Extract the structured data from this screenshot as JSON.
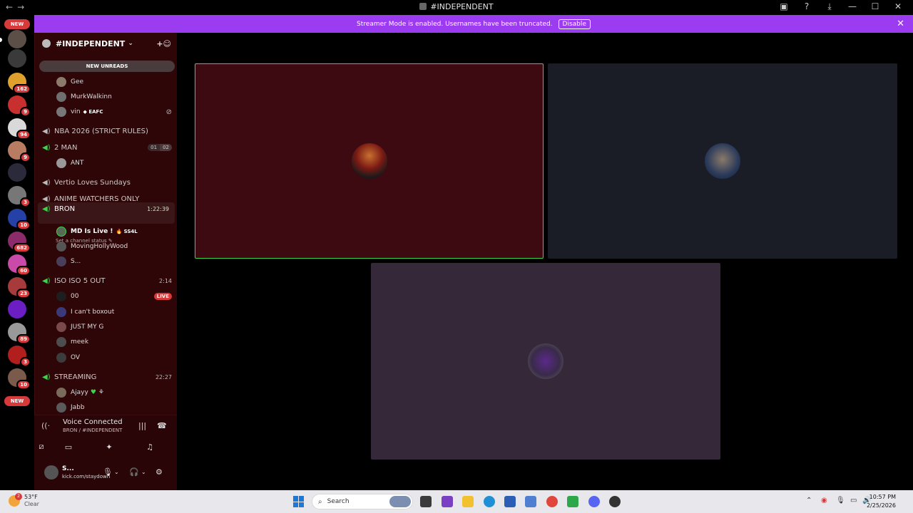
{
  "titlebar": {
    "title": "#INDEPENDENT",
    "nav_back": "←",
    "nav_fwd": "→"
  },
  "banner": {
    "text": "Streamer Mode is enabled. Usernames have been truncated.",
    "disable_label": "Disable",
    "close": "✕"
  },
  "rail": {
    "new_top": "NEW",
    "new_bottom": "NEW",
    "badges": [
      "162",
      "9",
      "94",
      "9",
      "3",
      "10",
      "682",
      "60",
      "23",
      "89",
      "3",
      "10"
    ]
  },
  "server": {
    "name": "#INDEPENDENT",
    "new_unreads": "NEW UNREADS"
  },
  "channels": {
    "users_top": [
      {
        "name": "Gee"
      },
      {
        "name": "MurkWalkinn"
      },
      {
        "name": "vin",
        "tag": "EAFC"
      }
    ],
    "nba": "NBA 2026 (STRICT RULES)",
    "two_man": "2 MAN",
    "two_man_count": "01",
    "two_man_limit": "02",
    "ant": "ANT",
    "vertio": "Vertio Loves Sundays",
    "anime": "ANIME WATCHERS ONLY",
    "bron": "BRON",
    "bron_time": "1:22:39",
    "bron_status": "Set a channel status",
    "bron_users": [
      {
        "name": "MD Is Live !",
        "tag": "SS4L"
      },
      {
        "name": "MovingHollyWood"
      },
      {
        "name": "S..."
      }
    ],
    "iso": "ISO ISO 5 OUT",
    "iso_time": "2:14",
    "iso_users": [
      {
        "name": "00",
        "live": "LIVE"
      },
      {
        "name": "I can't boxout"
      },
      {
        "name": "JUST MY G"
      },
      {
        "name": "meek"
      },
      {
        "name": "OV"
      }
    ],
    "streaming": "STREAMING",
    "streaming_time": "22:27",
    "streaming_users": [
      {
        "name": "Ajayy"
      },
      {
        "name": "Jabb"
      }
    ]
  },
  "voice": {
    "title": "Voice Connected",
    "sub": "BRON / #INDEPENDENT"
  },
  "user": {
    "name": "S...",
    "activity": "kick.com/staydown"
  },
  "taskbar": {
    "temp": "53°F",
    "cond": "Clear",
    "weather_badge": "2",
    "search": "Search",
    "time": "10:57 PM",
    "date": "2/25/2026"
  },
  "colors": {
    "banner": "#9b3cf0",
    "sidebar": "#2e0608",
    "tile_speaking": "#3d0a12",
    "tile_2": "#1b1d26",
    "tile_3": "#352839",
    "speaking_border": "#3ed34a",
    "live_red": "#d63a3a"
  }
}
